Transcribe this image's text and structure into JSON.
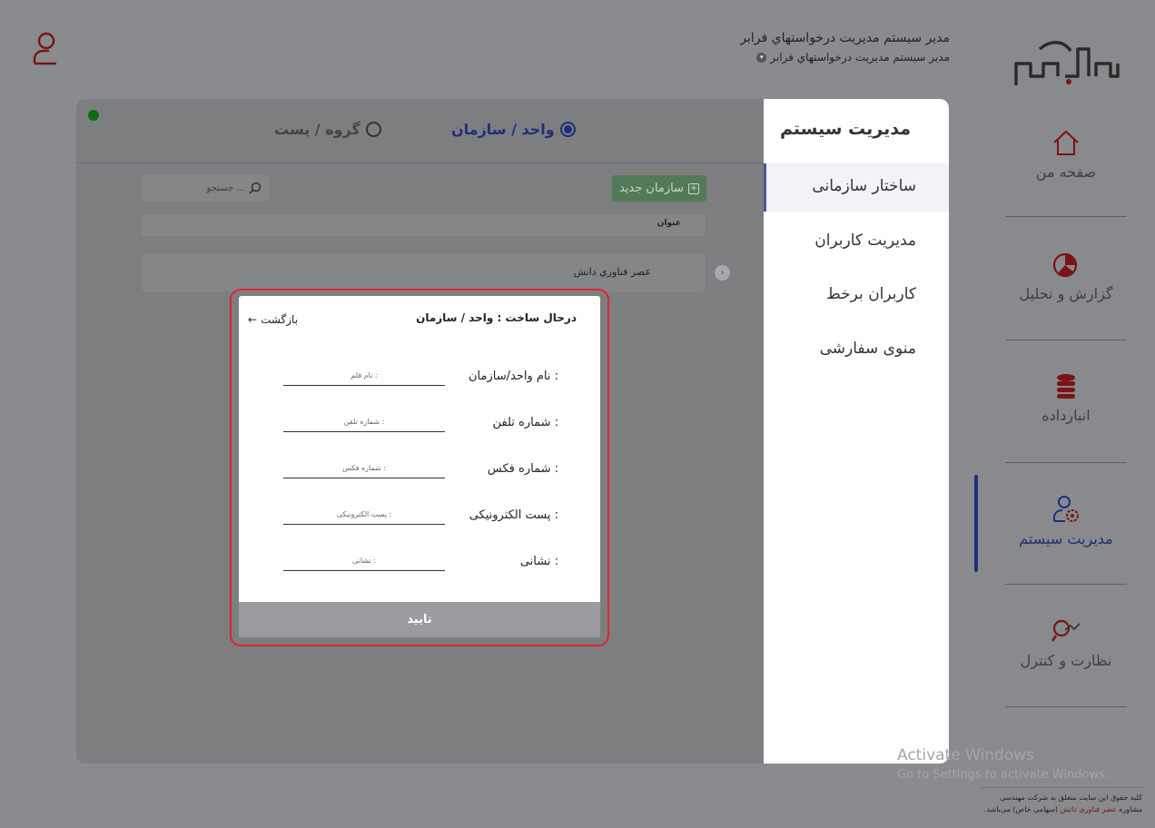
{
  "header": {
    "user_title": "مدير سيستم مديريت درخواستهاي فرابر",
    "user_role": "مدير سيستم مديريت درخواستهاي فرابر"
  },
  "nav": {
    "items": [
      {
        "label": "صفحه من",
        "icon": "home-icon"
      },
      {
        "label": "گزارش و تحلیل",
        "icon": "pie-chart-icon"
      },
      {
        "label": "انبارداده",
        "icon": "database-icon"
      },
      {
        "label": "مدیریت سیستم",
        "icon": "user-gear-icon"
      },
      {
        "label": "نظارت و کنترل",
        "icon": "magnifier-chart-icon"
      }
    ],
    "active": "مدیریت سیستم"
  },
  "settings_menu": {
    "heading": "مدیریت سیستم",
    "items": [
      "ساختار سازمانی",
      "مدیریت کاربران",
      "کاربران برخط",
      "منوی سفارشی"
    ]
  },
  "content": {
    "radio_unit": "واحد / سازمان",
    "radio_group": "گروه / پست",
    "search_placeholder": "جستجو ...",
    "new_org_label": "سازمان جدید",
    "title_column": "عنوان",
    "org_row_label": "عصر فناوري دانش"
  },
  "modal": {
    "title": "درحال ساخت : واحد / سازمان",
    "back_label": "بازگشت",
    "fields": [
      {
        "label": "نام واحد/سازمان :",
        "placeholder": "نام قلم :"
      },
      {
        "label": "شماره تلفن :",
        "placeholder": "شماره تلفن :"
      },
      {
        "label": "شماره فکس :",
        "placeholder": "شماره فکس :"
      },
      {
        "label": "پست الکترونیکی :",
        "placeholder": "پست الکترونیکی :"
      },
      {
        "label": "نشانی :",
        "placeholder": "نشانی :"
      }
    ],
    "confirm_label": "تایید"
  },
  "footer": {
    "line1": "کلیه حقوق این سایت متعلق به شرکت مهندسی",
    "line2_prefix": "مشاوره",
    "brand": "عصر فناوری دانش",
    "line2_suffix": "(سهامی خاص) می‌باشد."
  },
  "watermark": {
    "line1": "Activate Windows",
    "line2": "Go to Settings to activate Windows."
  },
  "colors": {
    "accent": "#1f2f78",
    "brand_red": "#7a1414",
    "highlight": "#e1232b",
    "success": "#0f6b16"
  }
}
